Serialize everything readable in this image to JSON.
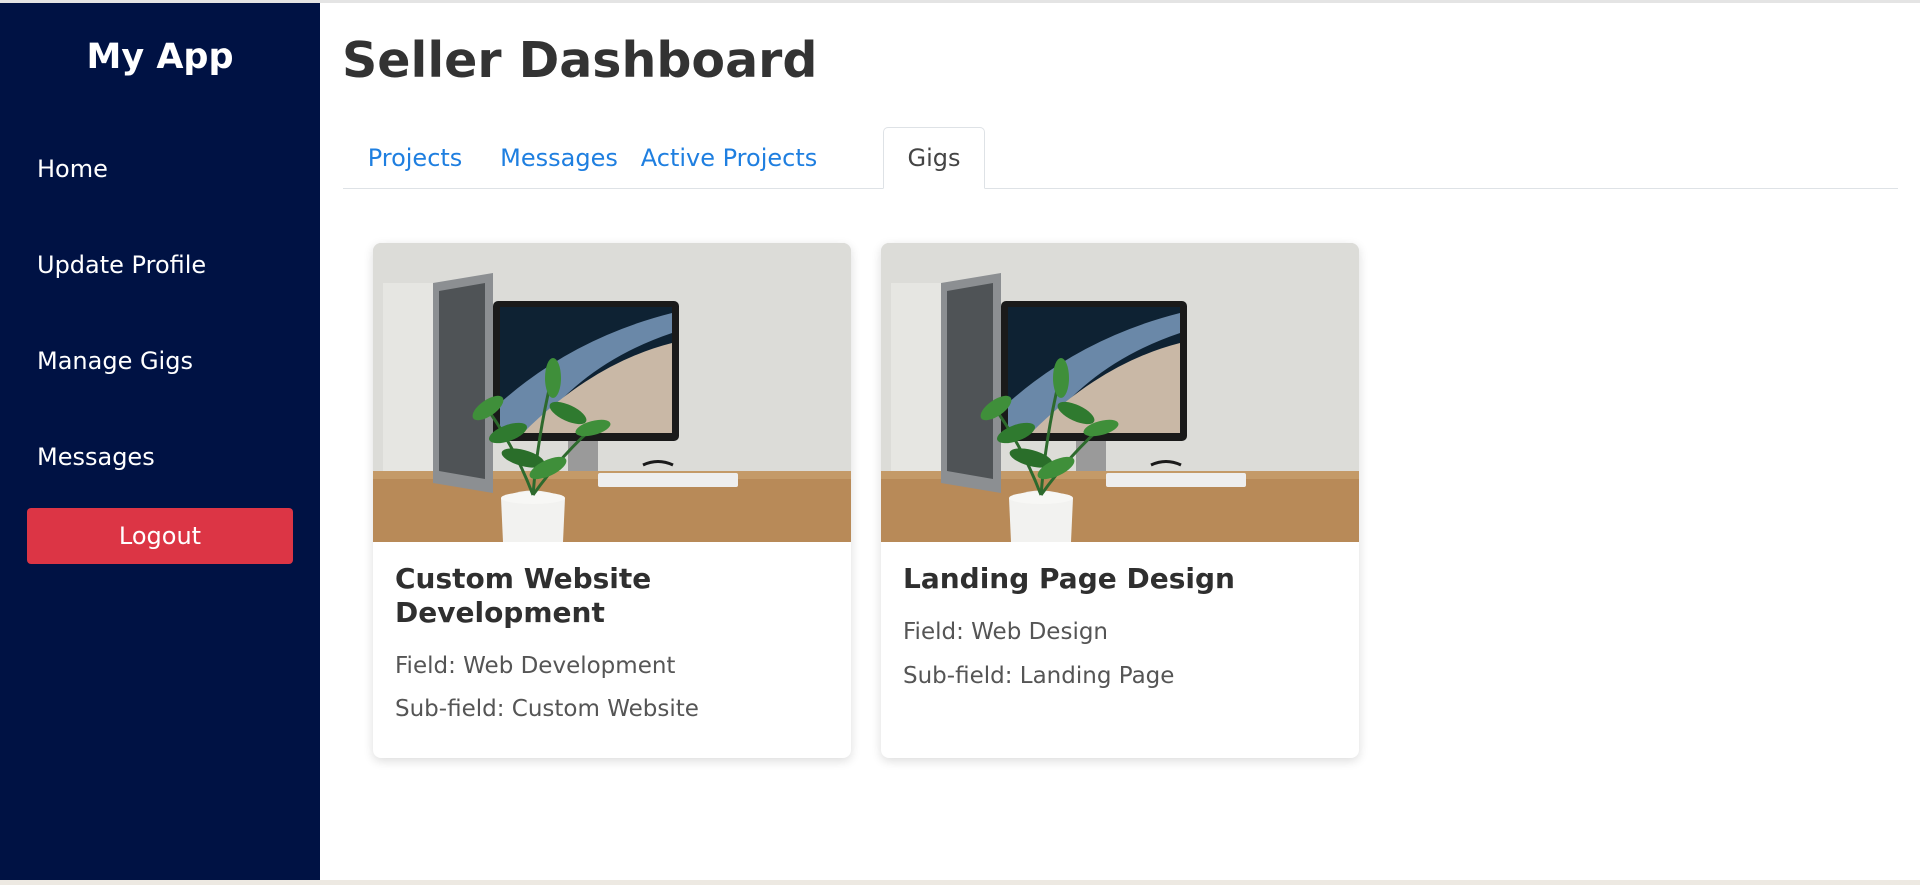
{
  "sidebar": {
    "brand": "My App",
    "items": [
      {
        "label": "Home"
      },
      {
        "label": "Update Profile"
      },
      {
        "label": "Manage Gigs"
      },
      {
        "label": "Messages"
      }
    ],
    "logout_label": "Logout"
  },
  "main": {
    "title": "Seller Dashboard",
    "tabs": [
      {
        "label": "Projects",
        "active": false
      },
      {
        "label": "Messages",
        "active": false
      },
      {
        "label": "Active Projects",
        "active": false
      },
      {
        "label": "Gigs",
        "active": true
      }
    ],
    "cards": [
      {
        "title": "Custom Website Development",
        "field": "Field: Web Development",
        "subfield": "Sub-field: Custom Website",
        "image": "desk-computer-plant-photo"
      },
      {
        "title": "Landing Page Design",
        "field": "Field: Web Design",
        "subfield": "Sub-field: Landing Page",
        "image": "desk-computer-plant-photo"
      }
    ]
  },
  "colors": {
    "sidebar_bg": "#001244",
    "logout_bg": "#dc3545",
    "tab_link": "#1f7fe0",
    "title_text": "#333333"
  }
}
